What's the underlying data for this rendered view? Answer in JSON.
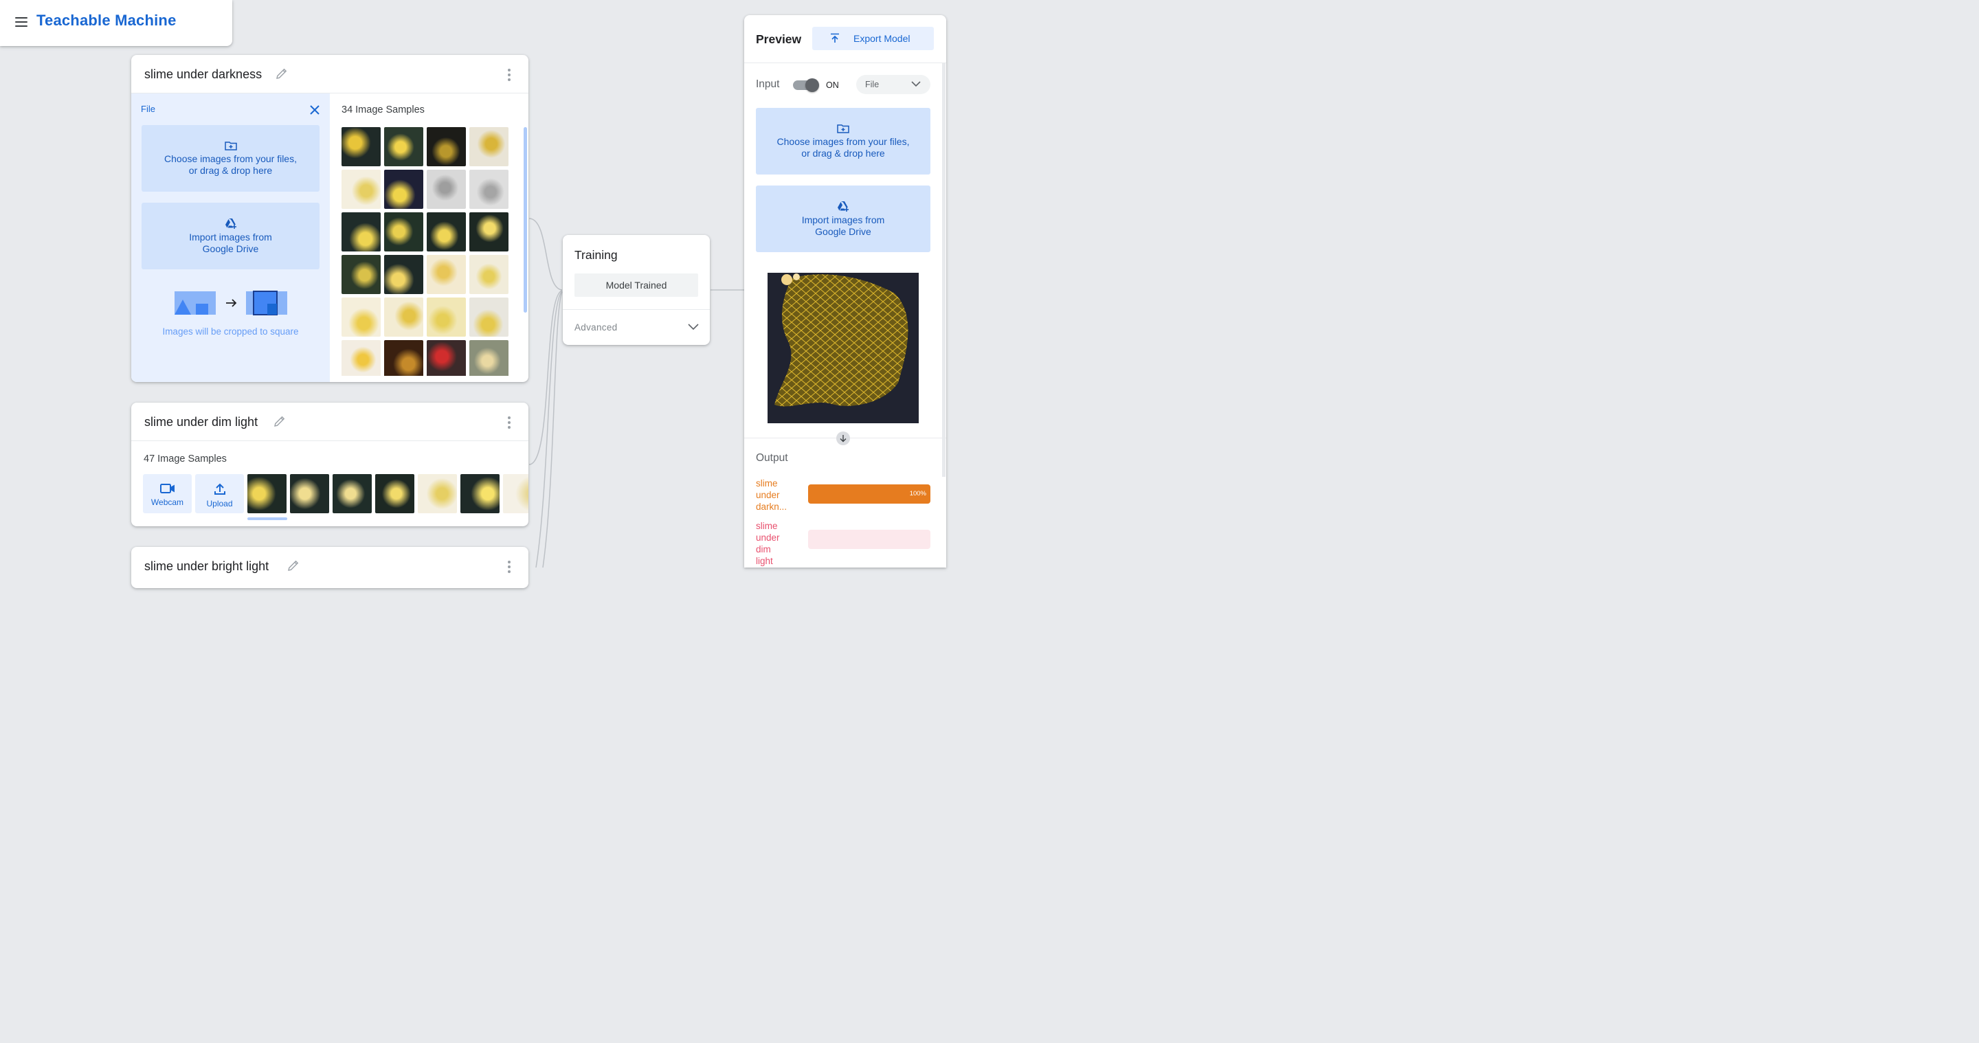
{
  "app": {
    "title": "Teachable Machine"
  },
  "classes": [
    {
      "name": "slime under darkness",
      "samples_label": "34 Image Samples",
      "file_panel": {
        "label": "File",
        "choose_line1": "Choose images from your files,",
        "choose_line2": "or drag & drop here",
        "drive_line1": "Import images from",
        "drive_line2": "Google Drive",
        "crop_note": "Images will be cropped to square"
      }
    },
    {
      "name": "slime under dim light",
      "samples_label": "47 Image Samples",
      "webcam_label": "Webcam",
      "upload_label": "Upload"
    },
    {
      "name": "slime under bright light"
    }
  ],
  "training": {
    "title": "Training",
    "status_button": "Model Trained",
    "advanced_label": "Advanced"
  },
  "preview": {
    "title": "Preview",
    "export_label": "Export Model",
    "input_label": "Input",
    "toggle_state": "ON",
    "input_source": "File",
    "choose_line1": "Choose images from your files,",
    "choose_line2": "or drag & drop here",
    "drive_line1": "Import images from",
    "drive_line2": "Google Drive",
    "output_label": "Output",
    "outputs": [
      {
        "name_lines": [
          "slime",
          "under",
          "darkn..."
        ],
        "confidence": 1.0,
        "percent_label": "100%",
        "color": "#e67c1f"
      },
      {
        "name_lines": [
          "slime",
          "under",
          "dim",
          "light"
        ],
        "confidence": 0.0,
        "color": "#e8506e"
      }
    ]
  },
  "colors": {
    "accent": "#1967d2",
    "panel": "#e8f0fe",
    "output_orange": "#e67c1f",
    "output_pink": "#e8506e"
  }
}
